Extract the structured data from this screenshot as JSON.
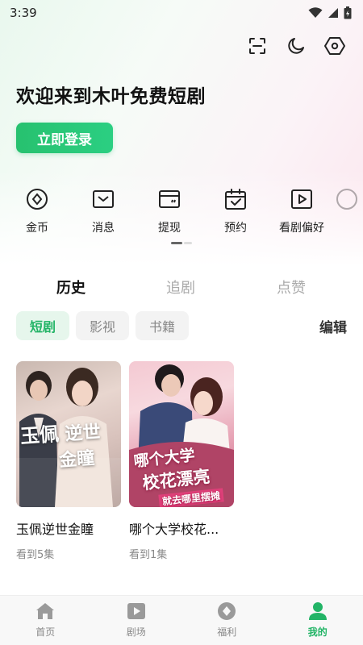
{
  "status_bar": {
    "time": "3:39"
  },
  "top_actions": [
    "scan-icon",
    "moon-icon",
    "settings-hex-icon"
  ],
  "welcome_text": "欢迎来到木叶免费短剧",
  "login_button": "立即登录",
  "shortcuts": [
    {
      "label": "金币",
      "icon": "coin-icon"
    },
    {
      "label": "消息",
      "icon": "message-icon"
    },
    {
      "label": "提现",
      "icon": "withdraw-icon"
    },
    {
      "label": "预约",
      "icon": "reserve-icon"
    },
    {
      "label": "看剧偏好",
      "icon": "play-preference-icon"
    }
  ],
  "main_tabs": [
    {
      "label": "历史",
      "active": true
    },
    {
      "label": "追剧",
      "active": false
    },
    {
      "label": "点赞",
      "active": false
    }
  ],
  "sub_tabs": [
    {
      "label": "短剧",
      "active": true
    },
    {
      "label": "影视",
      "active": false
    },
    {
      "label": "书籍",
      "active": false
    }
  ],
  "edit_label": "编辑",
  "history_items": [
    {
      "title": "玉佩逆世金瞳",
      "progress": "看到5集",
      "poster_text": [
        "玉佩",
        "逆世",
        "金瞳"
      ]
    },
    {
      "title": "哪个大学校花...",
      "progress": "看到1集",
      "poster_text": [
        "哪个大学",
        "校花漂亮",
        "就去哪里摆摊"
      ]
    }
  ],
  "bottom_nav": [
    {
      "label": "首页",
      "icon": "home-icon",
      "active": false
    },
    {
      "label": "剧场",
      "icon": "theater-icon",
      "active": false
    },
    {
      "label": "福利",
      "icon": "welfare-icon",
      "active": false
    },
    {
      "label": "我的",
      "icon": "profile-icon",
      "active": true
    }
  ],
  "colors": {
    "accent": "#22b466",
    "login_gradient_start": "#27c16f",
    "login_gradient_end": "#2bcf82"
  }
}
